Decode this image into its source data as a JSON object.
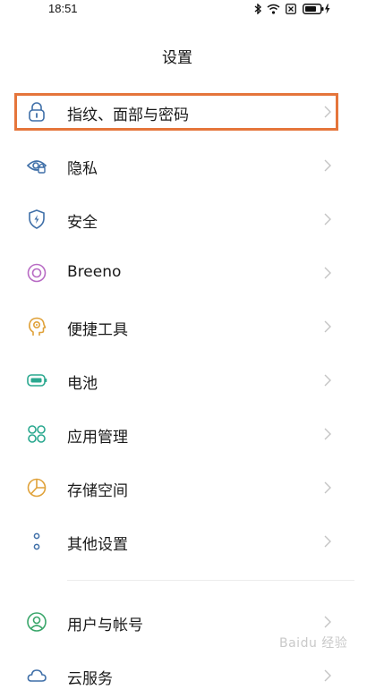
{
  "status_bar": {
    "time": "18:51",
    "icons": [
      "bluetooth-icon",
      "wifi-icon",
      "sim-icon",
      "battery-charging-icon"
    ]
  },
  "header": {
    "title": "设置"
  },
  "settings": {
    "items": [
      {
        "label": "指纹、面部与密码",
        "icon": "lock-icon",
        "color": "#3f6fa8"
      },
      {
        "label": "隐私",
        "icon": "privacy-eye-icon",
        "color": "#3f6fa8"
      },
      {
        "label": "安全",
        "icon": "shield-icon",
        "color": "#3f6fa8"
      },
      {
        "label": "Breeno",
        "icon": "breeno-icon",
        "color": "#b86bc4"
      },
      {
        "label": "便捷工具",
        "icon": "head-gear-icon",
        "color": "#e0a23a"
      },
      {
        "label": "电池",
        "icon": "battery-icon",
        "color": "#2aa88f"
      },
      {
        "label": "应用管理",
        "icon": "apps-icon",
        "color": "#2aa88f"
      },
      {
        "label": "存储空间",
        "icon": "pie-chart-icon",
        "color": "#e0a23a"
      },
      {
        "label": "其他设置",
        "icon": "more-dots-icon",
        "color": "#3f6fa8"
      },
      {
        "label": "用户与帐号",
        "icon": "user-icon",
        "color": "#39a66a"
      },
      {
        "label": "云服务",
        "icon": "cloud-icon",
        "color": "#3f6fa8"
      }
    ]
  },
  "highlight_color": "#e5753b",
  "watermark": {
    "text": "Baidu 经验"
  }
}
